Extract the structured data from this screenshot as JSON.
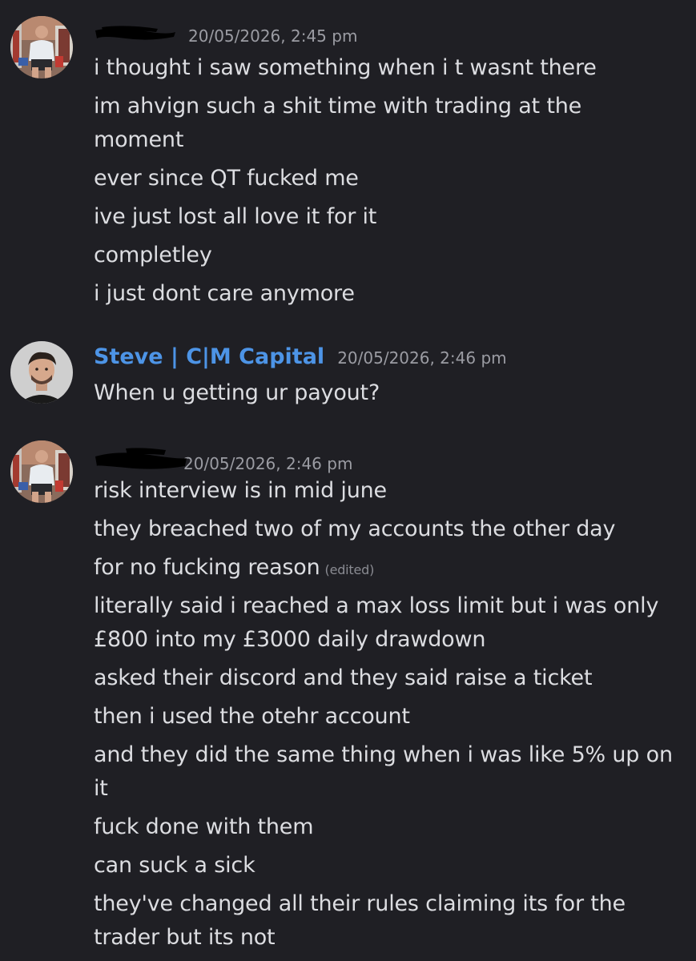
{
  "messages": [
    {
      "author": "",
      "author_redacted": true,
      "timestamp": "20/05/2026, 2:45 pm",
      "lines": [
        {
          "text": "i thought i saw something when i t wasnt there"
        },
        {
          "text": "im ahvign such a shit time with trading at the moment"
        },
        {
          "text": "ever since QT fucked me"
        },
        {
          "text": "ive just lost all love it for it"
        },
        {
          "text": "completley"
        },
        {
          "text": "i just dont care anymore"
        }
      ]
    },
    {
      "author": "Steve | C|M Capital",
      "author_redacted": false,
      "timestamp": "20/05/2026, 2:46 pm",
      "lines": [
        {
          "text": "When u getting ur payout?"
        }
      ]
    },
    {
      "author": "",
      "author_redacted": true,
      "timestamp": "20/05/2026, 2:46 pm",
      "lines": [
        {
          "text": "risk interview is in mid june"
        },
        {
          "text": "they breached two of my accounts the other day"
        },
        {
          "text": "for no fucking reason",
          "edited": "(edited)"
        },
        {
          "text": "literally said i reached a max loss limit but i was only £800 into my £3000 daily drawdown"
        },
        {
          "text": "asked their discord and they said raise a ticket"
        },
        {
          "text": "then i used the otehr account"
        },
        {
          "text": "and they did the same thing when i was like 5% up on it"
        },
        {
          "text": "fuck done with them"
        },
        {
          "text": "can suck a sick"
        },
        {
          "text": "they've changed all their rules claiming its for the trader but its not"
        }
      ]
    }
  ],
  "colors": {
    "background": "#1f1f24",
    "username": "#4d94e6",
    "text": "#dcdde1",
    "timestamp": "#9b9ca3"
  }
}
